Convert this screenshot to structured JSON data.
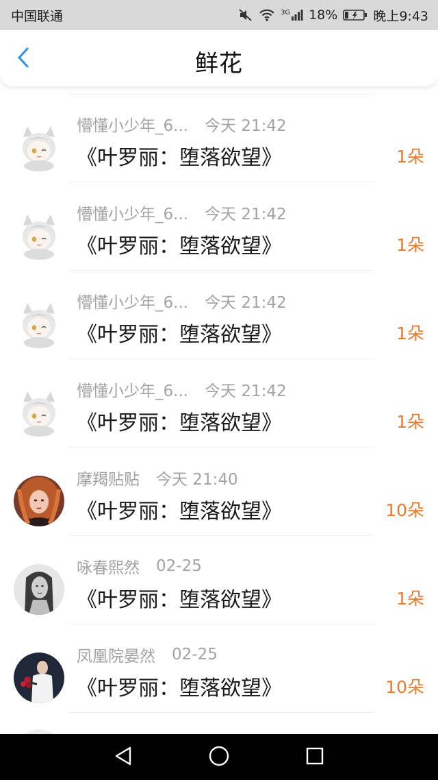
{
  "status_bar": {
    "carrier": "中国联通",
    "network": "3G",
    "battery": "18%",
    "time": "晚上9:43",
    "icons": [
      "mute-icon",
      "wifi-icon",
      "signal-icon",
      "battery-icon"
    ]
  },
  "header": {
    "title": "鲜花",
    "back_icon": "chevron-left-icon",
    "accent_color": "#2b8fe8"
  },
  "items": [
    {
      "user": "懵懂小少年_6...",
      "time": "今天 21:42",
      "book": "《叶罗丽：堕落欲望》",
      "count": "1朵",
      "avatar": "anime-cat-girl"
    },
    {
      "user": "懵懂小少年_6...",
      "time": "今天 21:42",
      "book": "《叶罗丽：堕落欲望》",
      "count": "1朵",
      "avatar": "anime-cat-girl"
    },
    {
      "user": "懵懂小少年_6...",
      "time": "今天 21:42",
      "book": "《叶罗丽：堕落欲望》",
      "count": "1朵",
      "avatar": "anime-cat-girl"
    },
    {
      "user": "懵懂小少年_6...",
      "time": "今天 21:42",
      "book": "《叶罗丽：堕落欲望》",
      "count": "1朵",
      "avatar": "anime-cat-girl"
    },
    {
      "user": "摩羯贴贴",
      "time": "今天 21:40",
      "book": "《叶罗丽：堕落欲望》",
      "count": "10朵",
      "avatar": "red-hair-girl"
    },
    {
      "user": "咏春熙然",
      "time": "02-25",
      "book": "《叶罗丽：堕落欲望》",
      "count": "1朵",
      "avatar": "grey-portrait"
    },
    {
      "user": "凤凰院晏然",
      "time": "02-25",
      "book": "《叶罗丽：堕落欲望》",
      "count": "10朵",
      "avatar": "dark-portrait"
    }
  ],
  "colors": {
    "count": "#ea7a2c",
    "meta": "#a3a3a3",
    "title": "#1a1a1a",
    "status_bg": "#d9d9d9"
  },
  "nav": {
    "back": "triangle-back-icon",
    "home": "circle-home-icon",
    "recents": "square-recents-icon"
  }
}
